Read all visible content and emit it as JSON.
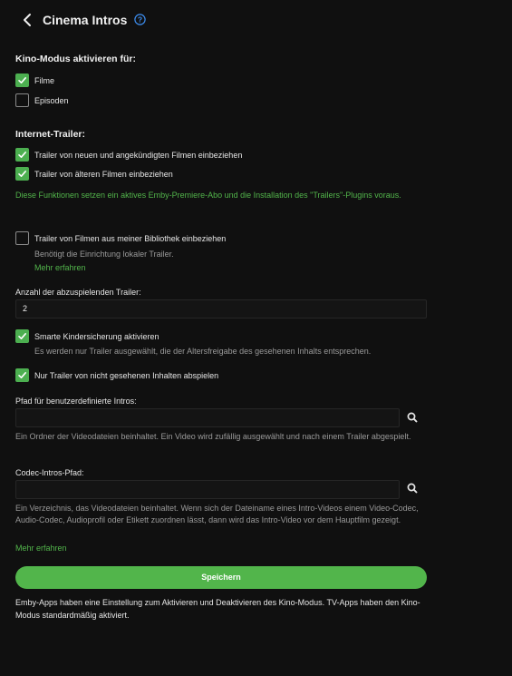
{
  "header": {
    "title": "Cinema Intros"
  },
  "cinema_mode": {
    "title": "Kino-Modus aktivieren für:",
    "movies_label": "Filme",
    "movies_checked": true,
    "episodes_label": "Episoden",
    "episodes_checked": false
  },
  "internet_trailers": {
    "title": "Internet-Trailer:",
    "new_label": "Trailer von neuen und angekündigten Filmen einbeziehen",
    "new_checked": true,
    "old_label": "Trailer von älteren Filmen einbeziehen",
    "old_checked": true,
    "note": "Diese Funktionen setzen ein aktives Emby-Premiere-Abo und die Installation des \"Trailers\"-Plugins voraus."
  },
  "library_trailers": {
    "label": "Trailer von Filmen aus meiner Bibliothek einbeziehen",
    "checked": false,
    "sub": "Benötigt die Einrichtung lokaler Trailer.",
    "link": "Mehr erfahren"
  },
  "trailer_count": {
    "label": "Anzahl der abzuspielenden Trailer:",
    "value": "2"
  },
  "parental_control": {
    "label": "Smarte Kindersicherung aktivieren",
    "checked": true,
    "sub": "Es werden nur Trailer ausgewählt, die der Altersfreigabe des gesehenen Inhalts entsprechen."
  },
  "unwatched_only": {
    "label": "Nur Trailer von nicht gesehenen Inhalten abspielen",
    "checked": true
  },
  "custom_intros": {
    "label": "Pfad für benutzerdefinierte Intros:",
    "value": "",
    "desc": "Ein Ordner der Videodateien beinhaltet. Ein Video wird zufällig ausgewählt und nach einem Trailer abgespielt."
  },
  "codec_intros": {
    "label": "Codec-Intros-Pfad:",
    "value": "",
    "desc": "Ein Verzeichnis, das Videodateien beinhaltet. Wenn sich der Dateiname eines Intro-Videos einem Video-Codec, Audio-Codec, Audioprofil oder Etikett zuordnen lässt, dann wird das Intro-Video vor dem Hauptfilm gezeigt.",
    "link": "Mehr erfahren"
  },
  "save_label": "Speichern",
  "footer_note": "Emby-Apps haben eine Einstellung zum Aktivieren und Deaktivieren des Kino-Modus. TV-Apps haben den Kino-Modus standardmäßig aktiviert.",
  "colors": {
    "accent": "#52b54b",
    "background": "#101010",
    "help_icon": "#3d8ef0"
  },
  "icons": [
    "back-arrow-icon",
    "help-icon",
    "check-icon",
    "search-icon"
  ]
}
